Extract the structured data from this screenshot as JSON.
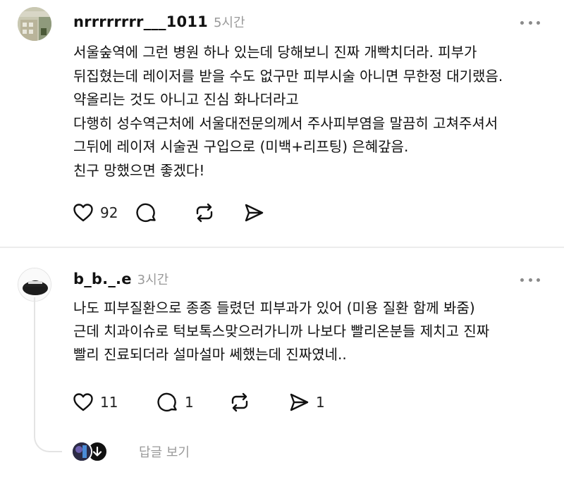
{
  "posts": [
    {
      "username": "nrrrrrrrr___1011",
      "time": "5시간",
      "lines": [
        "서울숲역에 그런 병원 하나 있는데 당해보니 진짜 개빡치더라. 피부가",
        "뒤집혔는데 레이저를 받을 수도 없구만 피부시술 아니면 무한정 대기랬음.",
        "약올리는 것도 아니고 진심 화나더라고",
        "다행히 성수역근처에 서울대전문의께서 주사피부염을 말끔히 고쳐주셔서",
        "그뒤에 레이져 시술권 구입으로 (미백+리프팅) 은혜갚음.",
        "친구 망했으면 좋겠다!"
      ],
      "likes": "92",
      "comments": "",
      "reposts": "",
      "shares": ""
    },
    {
      "username": "b_b._.e",
      "time": "3시간",
      "lines": [
        "나도 피부질환으로 종종 들렸던 피부과가 있어 (미용 질환 함께 봐줌)",
        "근데 치과이슈로 턱보톡스맞으러가니까 나보다 빨리온분들 제치고 진짜",
        "빨리 진료되더라 설마설마 쎄했는데 진짜였네.."
      ],
      "likes": "11",
      "comments": "1",
      "reposts": "",
      "shares": "1"
    }
  ],
  "replies_label": "답글 보기",
  "icons": {
    "like": "heart-icon",
    "comment": "speech-bubble-icon",
    "repost": "repost-icon",
    "share": "send-icon",
    "more": "more-dots-icon"
  },
  "colors": {
    "text": "#111111",
    "muted": "#9a9a9a",
    "divider": "#ececec"
  }
}
